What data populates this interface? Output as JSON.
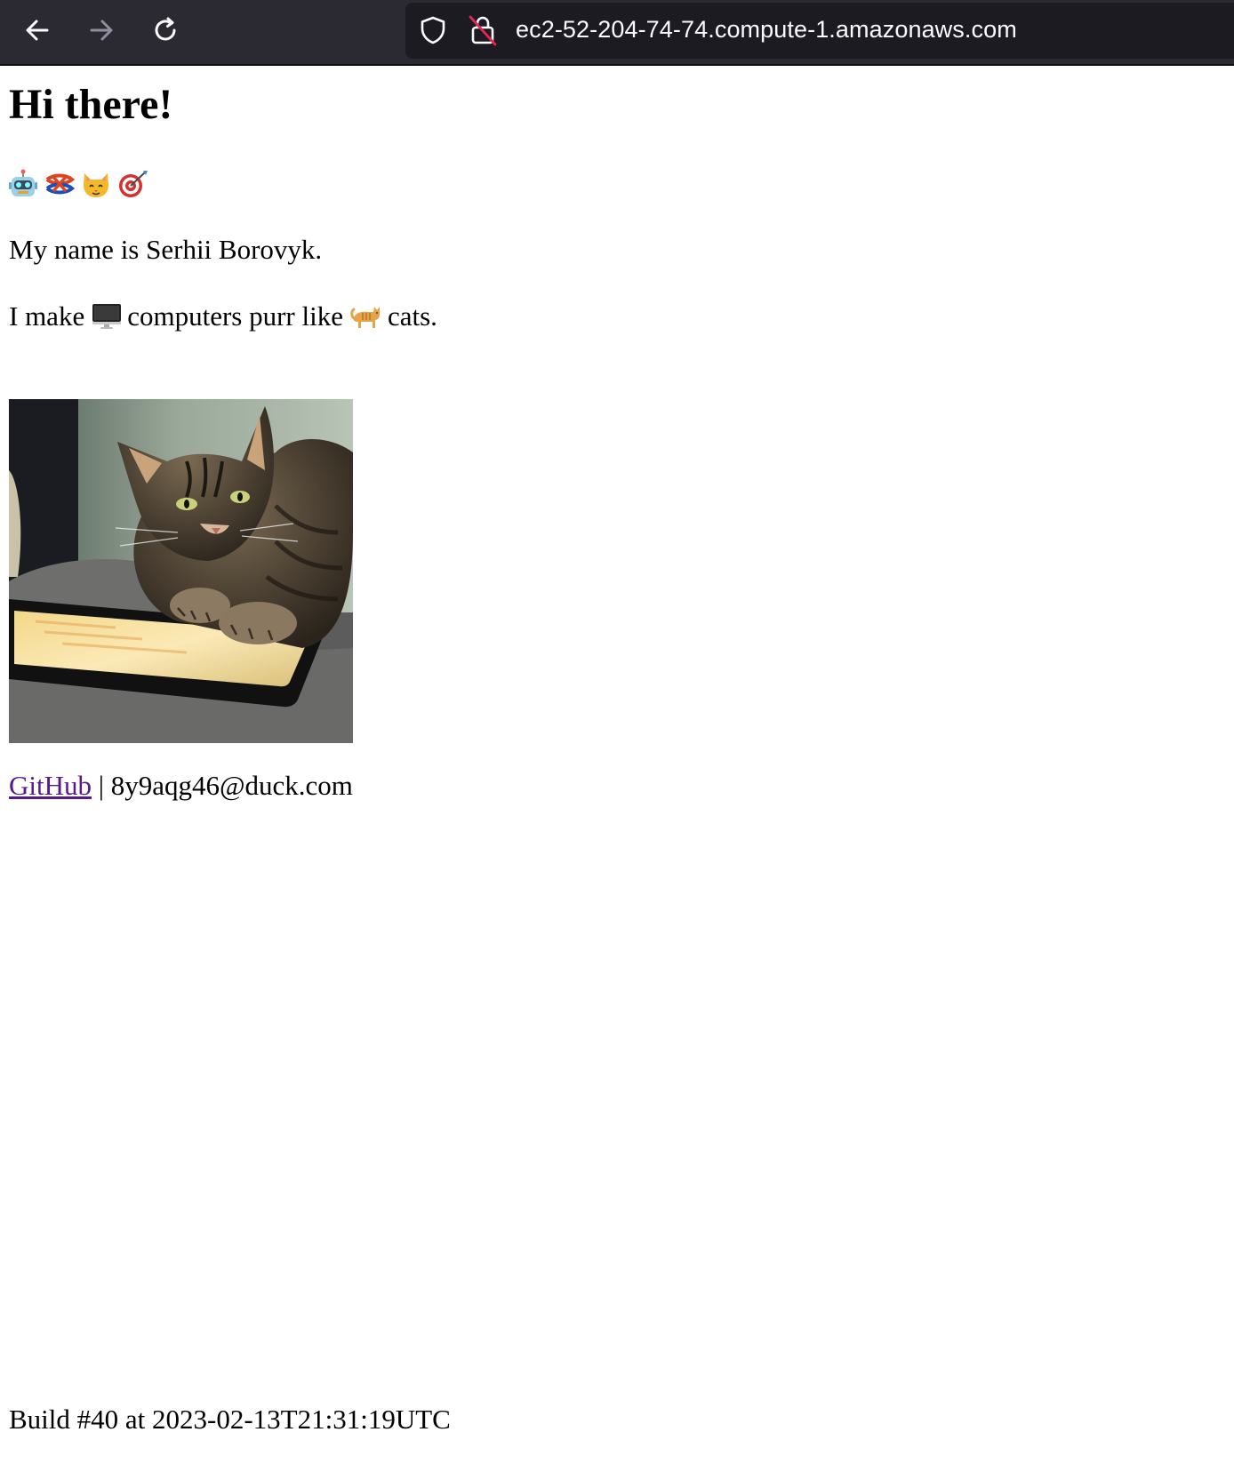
{
  "browser": {
    "url": "ec2-52-204-74-74.compute-1.amazonaws.com",
    "toolbar_bg": "#2b2a33",
    "urlbar_bg": "#1c1b22"
  },
  "page": {
    "heading": "Hi there!",
    "emojis": [
      "robot-icon",
      "knot-icon",
      "cat-face-icon",
      "dart-target-icon"
    ],
    "name_line": "My name is Serhii Borovyk.",
    "tagline": {
      "before": "I make",
      "middle": "computers purr like",
      "after": "cats.",
      "icons": [
        "desktop-computer-icon",
        "cat-icon"
      ]
    },
    "photo_icon": "cat-on-tablet-photo",
    "contact": {
      "github_label": "GitHub",
      "separator": " | ",
      "email": "8y9aqg46@duck.com",
      "link_color": "#551a8b"
    },
    "build_line": "Build #40 at 2023-02-13T21:31:19UTC"
  }
}
